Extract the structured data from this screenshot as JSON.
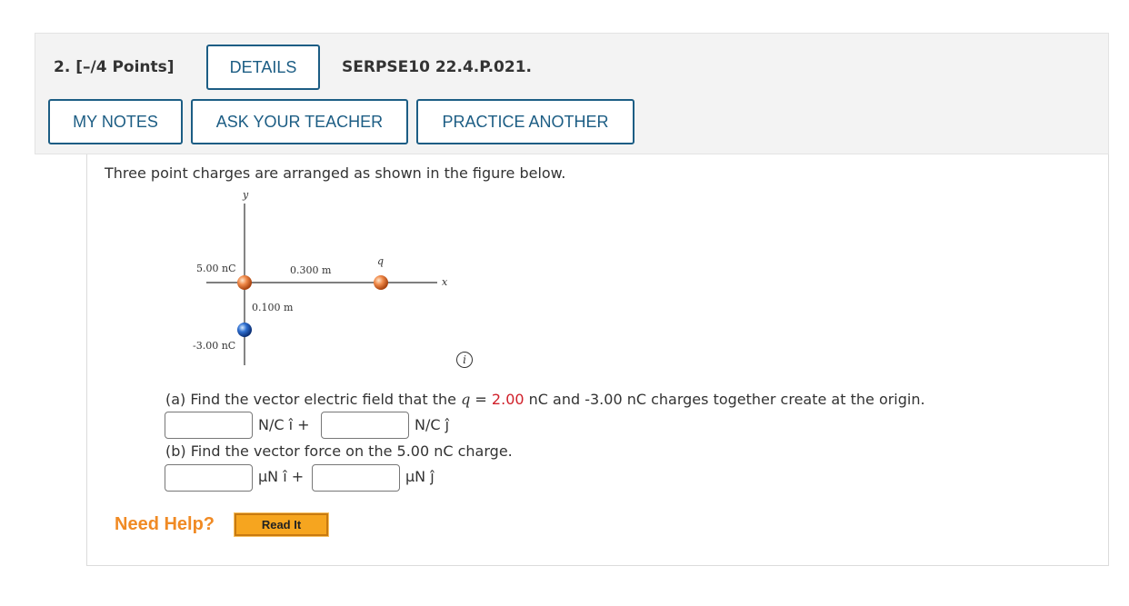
{
  "header": {
    "question_number": "2.",
    "points": "[–/4 Points]",
    "details_label": "DETAILS",
    "problem_code": "SERPSE10 22.4.P.021.",
    "my_notes_label": "MY NOTES",
    "ask_teacher_label": "ASK YOUR TEACHER",
    "practice_another_label": "PRACTICE ANOTHER"
  },
  "problem": {
    "intro": "Three point charges are arranged as shown in the figure below.",
    "figure": {
      "y_axis_label": "y",
      "x_axis_label": "x",
      "charge_top_label": "5.00 nC",
      "charge_bottom_label": "-3.00 nC",
      "charge_q_label": "q",
      "distance_x_label": "0.300 m",
      "distance_y_label": "0.100 m"
    },
    "info_icon_glyph": "i",
    "part_a": {
      "prefix": "(a) Find the vector electric field that the",
      "q_symbol": "q",
      "equals": "=",
      "q_value": "2.00",
      "suffix": "nC and -3.00 nC charges together create at the origin.",
      "unit_i": "N/C î +",
      "unit_j": "N/C ĵ",
      "input_i_value": "",
      "input_j_value": ""
    },
    "part_b": {
      "prompt": "(b) Find the vector force on the 5.00 nC charge.",
      "unit_i": "μN î +",
      "unit_j": "μN ĵ",
      "input_i_value": "",
      "input_j_value": ""
    },
    "need_help": "Need Help?",
    "read_it_label": "Read It"
  },
  "colors": {
    "accent_blue": "#1c5d84",
    "highlight_red": "#d0202a",
    "help_orange": "#f08a24",
    "read_it_bg": "#f6a51f"
  }
}
